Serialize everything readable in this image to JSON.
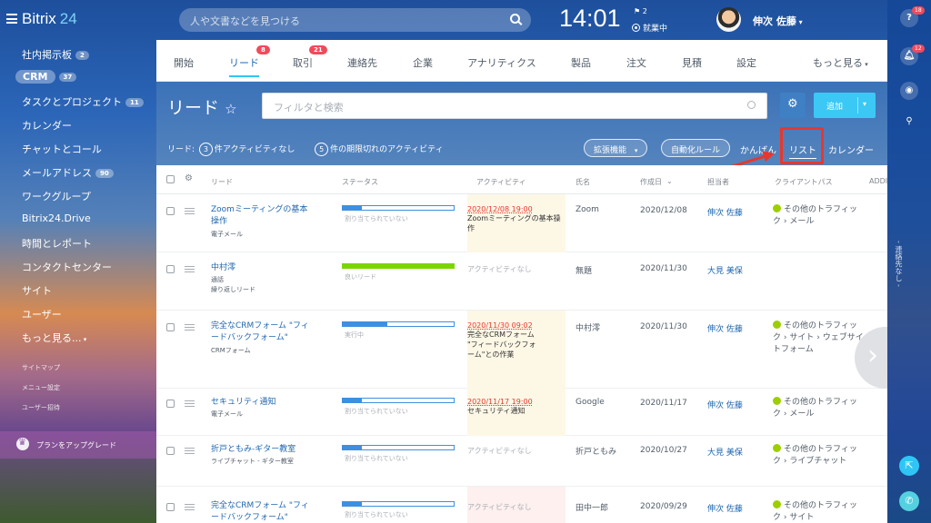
{
  "topbar": {
    "logo_main": "Bitrix",
    "logo_num": "24",
    "search_placeholder": "人や文書などを見つける",
    "time": "14:01",
    "flag_count": "2",
    "work_status": "就業中",
    "user_name": "伸次 佐藤"
  },
  "left_menu": {
    "items": [
      {
        "label": "社内掲示板",
        "badge": "2"
      },
      {
        "label": "CRM",
        "badge": "37"
      },
      {
        "label": "タスクとプロジェクト",
        "badge": "11"
      },
      {
        "label": "カレンダー"
      },
      {
        "label": "チャットとコール"
      },
      {
        "label": "メールアドレス",
        "badge": "90"
      },
      {
        "label": "ワークグループ"
      },
      {
        "label": "Bitrix24.Drive"
      },
      {
        "label": "時間とレポート"
      },
      {
        "label": "コンタクトセンター"
      },
      {
        "label": "サイト"
      },
      {
        "label": "ユーザー"
      },
      {
        "label": "もっと見る..."
      }
    ],
    "small": [
      "サイトマップ",
      "メニュー設定",
      "ユーザー招待"
    ],
    "upgrade": "プランをアップグレード"
  },
  "right_bar": {
    "help_badge": "18",
    "bell_badge": "12",
    "vertical_text": "- 連絡先なし -"
  },
  "tabs": [
    {
      "label": "開始"
    },
    {
      "label": "リード",
      "badge": "8",
      "active": true
    },
    {
      "label": "取引",
      "badge": "21"
    },
    {
      "label": "連絡先"
    },
    {
      "label": "企業"
    },
    {
      "label": "アナリティクス"
    },
    {
      "label": "製品"
    },
    {
      "label": "注文"
    },
    {
      "label": "見積"
    },
    {
      "label": "設定"
    },
    {
      "label": "もっと見る"
    }
  ],
  "page": {
    "title": "リード",
    "star": "☆",
    "filter_placeholder": "フィルタと検索",
    "add_label": "追加",
    "counter_prefix": "リード:",
    "counter1_num": "3",
    "counter1_text": "件アクティビティなし",
    "counter2_num": "5",
    "counter2_text": "件の期限切れのアクティビティ",
    "ext_label": "拡張機能",
    "automation_label": "自動化ルール",
    "view_kanban": "かんばん",
    "view_list": "リスト",
    "view_calendar": "カレンダー"
  },
  "grid": {
    "columns": [
      "リード",
      "ステータス",
      "アクティビティ",
      "氏名",
      "作成日",
      "担当者",
      "クライアントパス",
      "ADDI"
    ],
    "rows": [
      {
        "title": "Zoomミーティングの基本操作",
        "sub": "電子メール",
        "status": "割り当てられていない",
        "progress": 0.17,
        "bar_color": "#3e8fe0",
        "act_date": "2020/12/08 19:00",
        "act_text": "Zoomミーティングの基本操作",
        "name": "Zoom",
        "date": "2020/12/08",
        "owner": "伸次 佐藤",
        "path": [
          "その他のトラフィック",
          "メール"
        ]
      },
      {
        "title": "中村澪",
        "sub": "通話\n繰り返しリード",
        "status": "良いリード",
        "progress": 1.0,
        "bar_color": "#7bd500",
        "act_none": "アクティビティなし",
        "name": "無題",
        "date": "2020/11/30",
        "owner": "大見 美保",
        "path": []
      },
      {
        "title": "完全なCRMフォーム \"フィードバックフォーム\"",
        "sub": "CRMフォーム",
        "status": "実行中",
        "progress": 0.4,
        "bar_color": "#3e8fe0",
        "act_date": "2020/11/30 09:02",
        "act_text": "完全なCRMフォーム \"フィードバックフォーム\"との作業",
        "name": "中村澪",
        "date": "2020/11/30",
        "owner": "伸次 佐藤",
        "path": [
          "その他のトラフィック",
          "サイト",
          "ウェブサイトフォーム"
        ]
      },
      {
        "title": "セキュリティ通知",
        "sub": "電子メール",
        "status": "割り当てられていない",
        "progress": 0.17,
        "bar_color": "#3e8fe0",
        "act_date": "2020/11/17 19:00",
        "act_text": "セキュリティ通知",
        "name": "Google",
        "date": "2020/11/17",
        "owner": "伸次 佐藤",
        "path": [
          "その他のトラフィック",
          "メール"
        ]
      },
      {
        "title": "折戸ともみ-ギター教室",
        "sub": "ライブチャット - ギター教室",
        "status": "割り当てられていない",
        "progress": 0.17,
        "bar_color": "#3e8fe0",
        "act_none": "アクティビティなし",
        "name": "折戸ともみ",
        "date": "2020/10/27",
        "owner": "大見 美保",
        "path": [
          "その他のトラフィック",
          "ライブチャット"
        ]
      },
      {
        "title": "完全なCRMフォーム \"フィードバックフォーム\"",
        "sub": "",
        "status": "割り当てられていない",
        "progress": 0.17,
        "bar_color": "#3e8fe0",
        "act_none": "アクティビティなし",
        "name": "田中一郎",
        "date": "2020/09/29",
        "owner": "伸次 佐藤",
        "path": [
          "その他のトラフィック",
          "サイト"
        ]
      }
    ]
  }
}
